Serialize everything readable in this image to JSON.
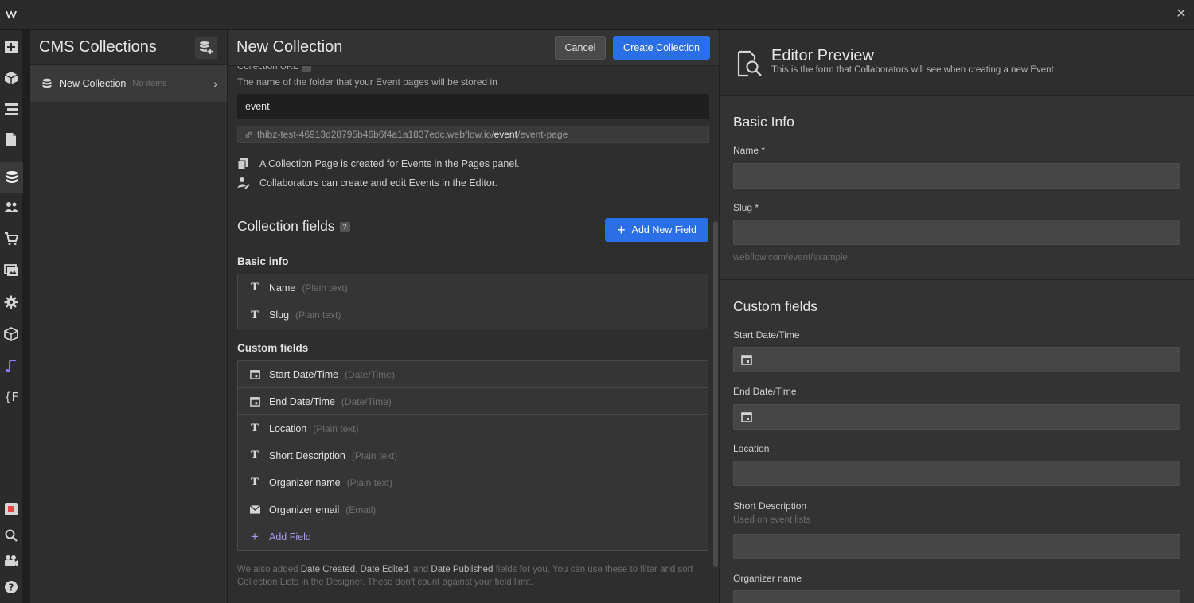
{
  "app": {
    "logo_text": "W"
  },
  "iconbar": {
    "items": [
      "add-icon",
      "box-icon",
      "navigator-icon",
      "pages-icon",
      "cms-icon",
      "users-icon",
      "ecommerce-icon",
      "assets-icon",
      "settings-icon",
      "apps-icon",
      "interactions-icon",
      "variables-icon",
      "record-icon",
      "search-icon",
      "video-icon",
      "help-icon"
    ],
    "active": "cms-icon"
  },
  "cms": {
    "title": "CMS Collections",
    "items": [
      {
        "name": "New Collection",
        "meta": "No items"
      }
    ]
  },
  "new_collection": {
    "title": "New Collection",
    "cancel_label": "Cancel",
    "create_label": "Create Collection",
    "url_label": "Collection URL",
    "url_desc": "The name of the folder that your Event pages will be stored in",
    "slug_value": "event",
    "url_prefix": "thibz-test-46913d28795b46b6f4a1a1837edc.webflow.io/",
    "url_slug": "event",
    "url_suffix": "/event-page",
    "info1": "A Collection Page is created for Events in the Pages panel.",
    "info2": "Collaborators can create and edit Events in the Editor.",
    "fields_title": "Collection fields",
    "fields_help": "?",
    "add_new_field_label": "Add New Field",
    "basic_label": "Basic info",
    "basic_fields": [
      {
        "name": "Name",
        "type": "(Plain text)",
        "icon": "T"
      },
      {
        "name": "Slug",
        "type": "(Plain text)",
        "icon": "T"
      }
    ],
    "custom_label": "Custom fields",
    "custom_fields": [
      {
        "name": "Start Date/Time",
        "type": "(Date/Time)",
        "icon": "calendar-icon"
      },
      {
        "name": "End Date/Time",
        "type": "(Date/Time)",
        "icon": "calendar-icon"
      },
      {
        "name": "Location",
        "type": "(Plain text)",
        "icon": "T"
      },
      {
        "name": "Short Description",
        "type": "(Plain text)",
        "icon": "T"
      },
      {
        "name": "Organizer name",
        "type": "(Plain text)",
        "icon": "T"
      },
      {
        "name": "Organizer email",
        "type": "(Email)",
        "icon": "mail-icon"
      }
    ],
    "add_field_label": "Add Field",
    "footnote_1": "We also added ",
    "footnote_b1": "Date Created",
    "footnote_2": ", ",
    "footnote_b2": "Date Edited",
    "footnote_3": ", and ",
    "footnote_b3": "Date Published",
    "footnote_4": " fields for you. You can use these to filter and sort Collection Lists in the Designer. These don't count against your field limit."
  },
  "editor_preview": {
    "title": "Editor Preview",
    "subtitle": "This is the form that Collaborators will see when creating a new Event",
    "basic_title": "Basic Info",
    "name_label": "Name *",
    "slug_label": "Slug *",
    "slug_hint": "webflow.com/event/example",
    "custom_title": "Custom fields",
    "start_label": "Start Date/Time",
    "end_label": "End Date/Time",
    "location_label": "Location",
    "short_desc_label": "Short Description",
    "short_desc_hint": "Used on event lists",
    "organizer_label": "Organizer name"
  }
}
